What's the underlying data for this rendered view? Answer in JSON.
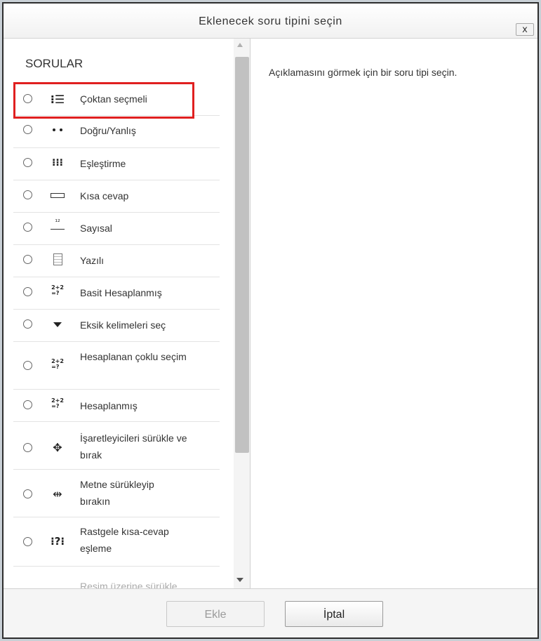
{
  "dialog": {
    "title": "Eklenecek soru tipini seçin",
    "close_label": "x"
  },
  "sidebar": {
    "section_title": "SORULAR",
    "items": [
      {
        "label": "Çoktan seçmeli",
        "icon": "list-icon",
        "glyph": "⁝☰",
        "selected": false
      },
      {
        "label": "Doğru/Yanlış",
        "icon": "two-dots-icon",
        "glyph": "",
        "selected": false
      },
      {
        "label": "Eşleştirme",
        "icon": "matching-icon",
        "glyph": "⁝⁝⁝",
        "selected": false
      },
      {
        "label": "Kısa cevap",
        "icon": "short-answer-icon",
        "glyph": "",
        "selected": false
      },
      {
        "label": "Sayısal",
        "icon": "numerical-icon",
        "glyph": "¹²",
        "selected": false
      },
      {
        "label": "Yazılı",
        "icon": "essay-icon",
        "glyph": "",
        "selected": false
      },
      {
        "label": "Basit Hesaplanmış",
        "icon": "calc-simple-icon",
        "glyph": "2+2\n=?",
        "selected": false
      },
      {
        "label": "Eksik kelimeleri seç",
        "icon": "dropdown-triangle-icon",
        "glyph": "",
        "selected": false
      },
      {
        "label": "Hesaplanan çoklu seçim",
        "icon": "calc-multi-icon",
        "glyph": "2+2\n=?",
        "selected": false
      },
      {
        "label": "Hesaplanmış",
        "icon": "calculated-icon",
        "glyph": "2+2\n=?",
        "selected": false
      },
      {
        "label": "İşaretleyicileri sürükle ve bırak",
        "icon": "drag-markers-icon",
        "glyph": "✥",
        "selected": false
      },
      {
        "label": "Metne sürükleyip bırakın",
        "icon": "drag-text-icon",
        "glyph": "⇹",
        "selected": false
      },
      {
        "label": "Rastgele kısa-cevap eşleme",
        "icon": "random-match-icon",
        "glyph": "⁝?⁝",
        "selected": false
      },
      {
        "label": "Resim üzerine sürükle",
        "icon": "drag-image-icon",
        "glyph": "",
        "selected": false
      }
    ]
  },
  "main": {
    "description": "Açıklamasını görmek için bir soru tipi seçin."
  },
  "footer": {
    "add_label": "Ekle",
    "cancel_label": "İptal"
  },
  "colors": {
    "highlight": "#e02020",
    "disabled_text": "#9b9b9b"
  }
}
